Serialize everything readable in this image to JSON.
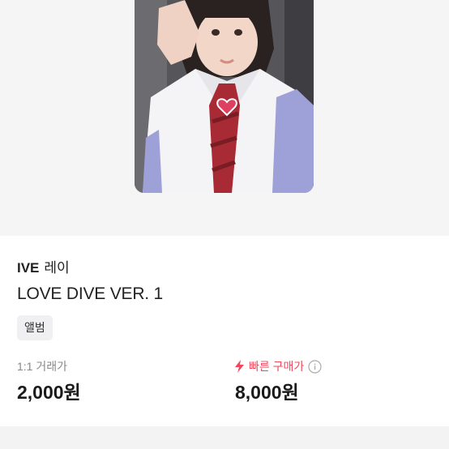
{
  "product": {
    "artist": "IVE",
    "member": "레이",
    "album": "LOVE DIVE VER. 1",
    "tag": "앨범"
  },
  "prices": {
    "trade": {
      "label": "1:1 거래가",
      "value": "2,000원"
    },
    "fast_buy": {
      "label": "빠른 구매가",
      "value": "8,000원",
      "accent_color": "#f0485a"
    }
  },
  "icons": {
    "bolt": "lightning-bolt-icon",
    "info": "info-circle-icon"
  }
}
